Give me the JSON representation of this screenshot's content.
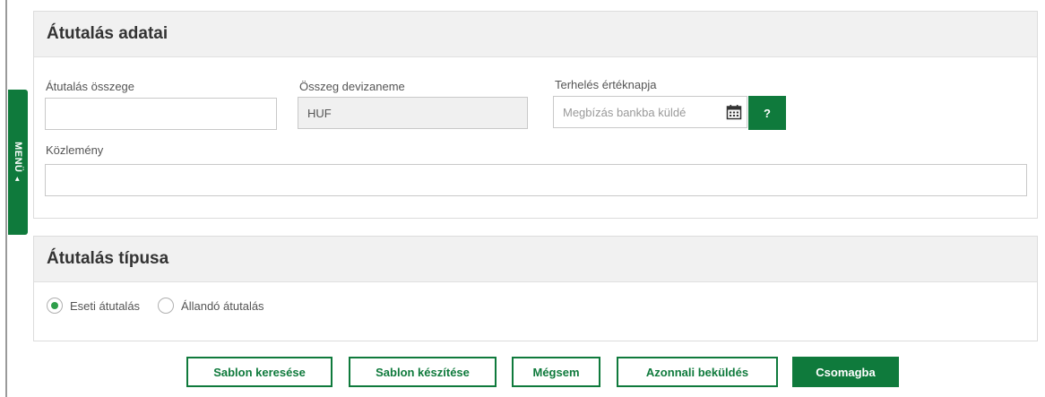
{
  "side_menu": {
    "label": "MENÜ",
    "arrow": "◄"
  },
  "transfer_details": {
    "title": "Átutalás adatai",
    "amount": {
      "label": "Átutalás összege",
      "value": ""
    },
    "currency": {
      "label": "Összeg devizaneme",
      "value": "HUF"
    },
    "value_date": {
      "label": "Terhelés értéknapja",
      "placeholder": "Megbízás bankba küldé",
      "calendar_icon": "calendar-icon",
      "help_label": "?"
    },
    "remark": {
      "label": "Közlemény",
      "value": ""
    }
  },
  "transfer_type": {
    "title": "Átutalás típusa",
    "options": [
      {
        "label": "Eseti átutalás",
        "selected": true
      },
      {
        "label": "Állandó átutalás",
        "selected": false
      }
    ]
  },
  "actions": {
    "search_template": "Sablon keresése",
    "create_template": "Sablon készítése",
    "cancel": "Mégsem",
    "send_now": "Azonnali beküldés",
    "add_to_package": "Csomagba"
  },
  "colors": {
    "brand_green": "#0f7a3c",
    "radio_selected": "#2e9e4a",
    "header_bg": "#f1f1f1"
  }
}
